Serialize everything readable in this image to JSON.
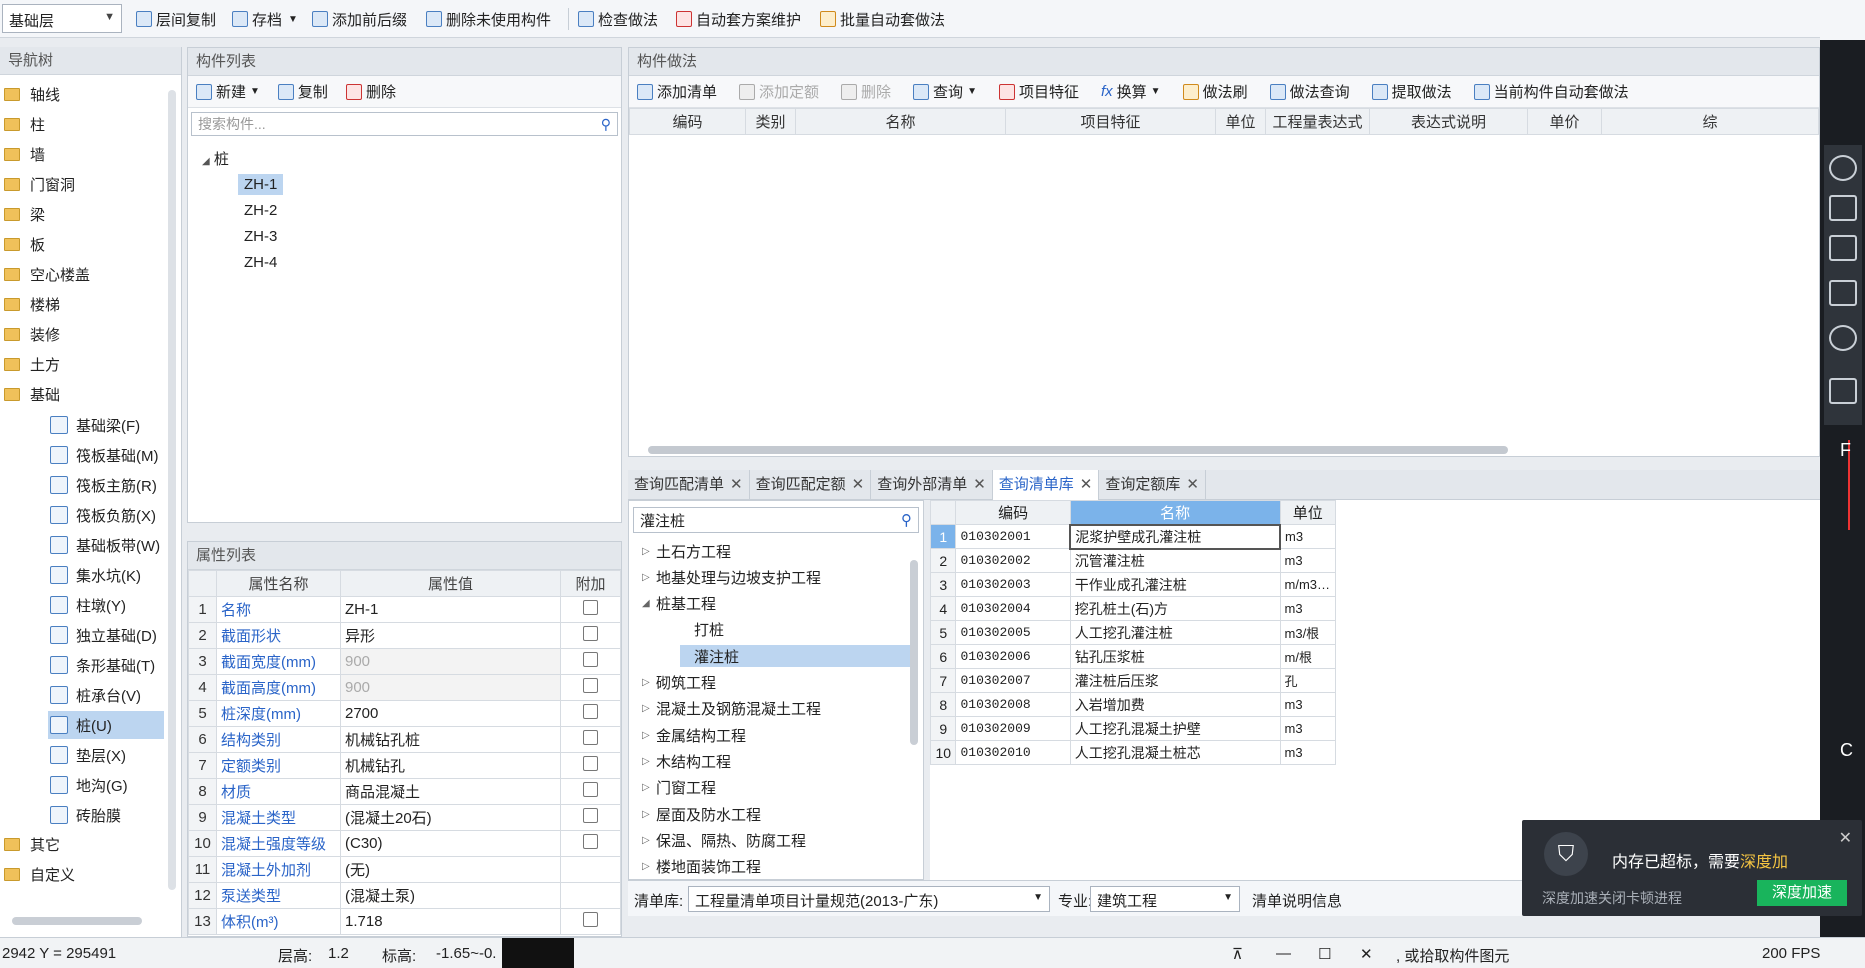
{
  "toolbar": {
    "floor": "基础层",
    "buttons": [
      "层间复制",
      "存档",
      "添加前后缀",
      "删除未使用构件",
      "检查做法",
      "自动套方案维护",
      "批量自动套做法"
    ]
  },
  "nav": {
    "title": "导航树",
    "items": [
      "轴线",
      "柱",
      "墙",
      "门窗洞",
      "梁",
      "板",
      "空心楼盖",
      "楼梯",
      "装修",
      "土方",
      "基础"
    ],
    "sub_items": [
      "基础梁(F)",
      "筏板基础(M)",
      "筏板主筋(R)",
      "筏板负筋(X)",
      "基础板带(W)",
      "集水坑(K)",
      "柱墩(Y)",
      "独立基础(D)",
      "条形基础(T)",
      "桩承台(V)",
      "桩(U)",
      "垫层(X)",
      "地沟(G)",
      "砖胎膜"
    ],
    "tail_items": [
      "其它",
      "自定义"
    ]
  },
  "component_list": {
    "title": "构件列表",
    "new_label": "新建",
    "copy_label": "复制",
    "delete_label": "删除",
    "search_placeholder": "搜索构件...",
    "root": "桩",
    "items": [
      "ZH-1",
      "ZH-2",
      "ZH-3",
      "ZH-4"
    ]
  },
  "properties": {
    "title": "属性列表",
    "headers": [
      "属性名称",
      "属性值",
      "附加"
    ],
    "rows": [
      {
        "n": "1",
        "name": "名称",
        "value": "ZH-1"
      },
      {
        "n": "2",
        "name": "截面形状",
        "value": "异形"
      },
      {
        "n": "3",
        "name": "截面宽度(mm)",
        "value": "900"
      },
      {
        "n": "4",
        "name": "截面高度(mm)",
        "value": "900"
      },
      {
        "n": "5",
        "name": "桩深度(mm)",
        "value": "2700"
      },
      {
        "n": "6",
        "name": "结构类别",
        "value": "机械钻孔桩"
      },
      {
        "n": "7",
        "name": "定额类别",
        "value": "机械钻孔"
      },
      {
        "n": "8",
        "name": "材质",
        "value": "商品混凝土"
      },
      {
        "n": "9",
        "name": "混凝土类型",
        "value": "(混凝土20石)"
      },
      {
        "n": "10",
        "name": "混凝土强度等级",
        "value": "(C30)"
      },
      {
        "n": "11",
        "name": "混凝土外加剂",
        "value": "(无)"
      },
      {
        "n": "12",
        "name": "泵送类型",
        "value": "(混凝土泵)"
      },
      {
        "n": "13",
        "name": "体积(m³)",
        "value": "1.718"
      }
    ]
  },
  "method": {
    "title": "构件做法",
    "buttons": [
      "添加清单",
      "添加定额",
      "删除",
      "查询",
      "项目特征",
      "换算",
      "做法刷",
      "做法查询",
      "提取做法",
      "当前构件自动套做法"
    ],
    "headers": [
      "编码",
      "类别",
      "名称",
      "项目特征",
      "单位",
      "工程量表达式",
      "表达式说明",
      "单价",
      "综"
    ]
  },
  "tabs": [
    "查询匹配清单",
    "查询匹配定额",
    "查询外部清单",
    "查询清单库",
    "查询定额库"
  ],
  "query": {
    "search_value": "灌注桩",
    "tree": [
      "土石方工程",
      "地基处理与边坡支护工程",
      "桩基工程",
      "打桩",
      "灌注桩",
      "砌筑工程",
      "混凝土及钢筋混凝土工程",
      "金属结构工程",
      "木结构工程",
      "门窗工程",
      "屋面及防水工程",
      "保温、隔热、防腐工程",
      "楼地面装饰工程"
    ],
    "headers": [
      "编码",
      "名称",
      "单位"
    ],
    "rows": [
      {
        "n": "1",
        "code": "010302001",
        "name": "泥浆护壁成孔灌注桩",
        "unit": "m3"
      },
      {
        "n": "2",
        "code": "010302002",
        "name": "沉管灌注桩",
        "unit": "m3"
      },
      {
        "n": "3",
        "code": "010302003",
        "name": "干作业成孔灌注桩",
        "unit": "m/m3…"
      },
      {
        "n": "4",
        "code": "010302004",
        "name": "挖孔桩土(石)方",
        "unit": "m3"
      },
      {
        "n": "5",
        "code": "010302005",
        "name": "人工挖孔灌注桩",
        "unit": "m3/根"
      },
      {
        "n": "6",
        "code": "010302006",
        "name": "钻孔压浆桩",
        "unit": "m/根"
      },
      {
        "n": "7",
        "code": "010302007",
        "name": "灌注桩后压浆",
        "unit": "孔"
      },
      {
        "n": "8",
        "code": "010302008",
        "name": "入岩增加费",
        "unit": "m3"
      },
      {
        "n": "9",
        "code": "010302009",
        "name": "人工挖孔混凝土护壁",
        "unit": "m3"
      },
      {
        "n": "10",
        "code": "010302010",
        "name": "人工挖孔混凝土桩芯",
        "unit": "m3"
      }
    ],
    "lib_label": "清单库:",
    "lib_value": "工程量清单项目计量规范(2013-广东)",
    "major_label": "专业:",
    "major_value": "建筑工程",
    "info_label": "清单说明信息"
  },
  "status": {
    "coords": "2942 Y = 295491",
    "floor_height_label": "层高:",
    "floor_height": "1.2",
    "elev_label": "标高:",
    "elev": "-1.65~-0.",
    "hint": ", 或拾取构件图元",
    "fps": "200 FPS"
  },
  "popup": {
    "message": "内存已超标，需要",
    "highlight": "深度加",
    "sub": "深度加速关闭卡顿进程",
    "button": "深度加速"
  },
  "axis_labels": [
    "F",
    "C"
  ]
}
